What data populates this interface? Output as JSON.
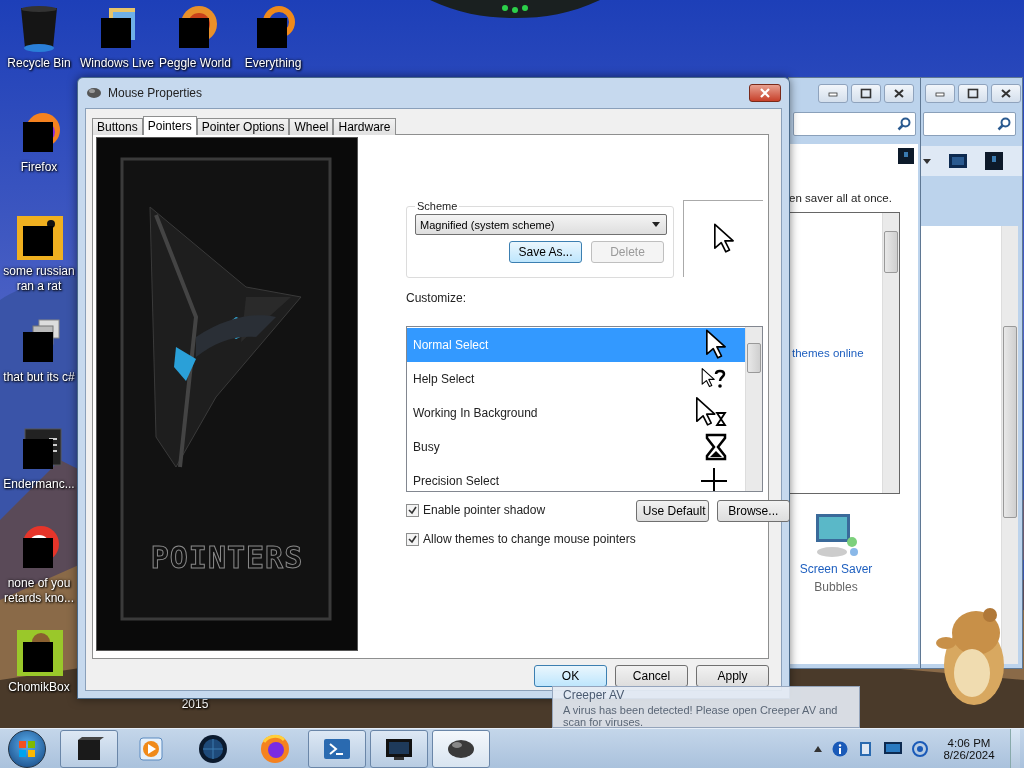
{
  "desktop_icons": [
    {
      "label": "Recycle Bin",
      "kind": "bin"
    },
    {
      "label": "Windows Live",
      "kind": "folders"
    },
    {
      "label": "Peggle World",
      "kind": "orb"
    },
    {
      "label": "Everything",
      "kind": "ring"
    },
    {
      "label": "Firefox",
      "kind": "firefox"
    },
    {
      "label": "some russian ran a rat",
      "kind": "tile"
    },
    {
      "label": "that but its c#",
      "kind": "windows"
    },
    {
      "label": "Endermanc...",
      "kind": "console"
    },
    {
      "label": "none of you retards kno...",
      "kind": "circle"
    },
    {
      "label": "ChomikBox",
      "kind": "green"
    },
    {
      "label": "2015",
      "kind": "hidden"
    }
  ],
  "window_a": {
    "text": "en saver all at once.",
    "link": "themes online",
    "item_title": "Screen Saver",
    "item_subtitle": "Bubbles"
  },
  "dialog": {
    "title": "Mouse Properties",
    "tabs": [
      {
        "label": "Buttons",
        "selected": false
      },
      {
        "label": "Pointers",
        "selected": true
      },
      {
        "label": "Pointer Options",
        "selected": false
      },
      {
        "label": "Wheel",
        "selected": false
      },
      {
        "label": "Hardware",
        "selected": false
      }
    ],
    "banner_text": "POINTERS",
    "scheme": {
      "label": "Scheme",
      "value": "Magnified (system scheme)",
      "buttons": [
        {
          "label": "Save As...",
          "disabled": false
        },
        {
          "label": "Delete",
          "disabled": true
        }
      ]
    },
    "customize_label": "Customize:",
    "pointers": [
      {
        "name": "Normal Select",
        "kind": "arrow",
        "selected": true
      },
      {
        "name": "Help Select",
        "kind": "help",
        "selected": false
      },
      {
        "name": "Working In Background",
        "kind": "working",
        "selected": false
      },
      {
        "name": "Busy",
        "kind": "busy",
        "selected": false
      },
      {
        "name": "Precision Select",
        "kind": "precision",
        "selected": false
      }
    ],
    "checkboxes": [
      {
        "label": "Enable pointer shadow",
        "checked": true
      },
      {
        "label": "Allow themes to change mouse pointers",
        "checked": true
      }
    ],
    "side_buttons": [
      "Use Default",
      "Browse..."
    ],
    "footer_buttons": [
      {
        "label": "OK",
        "default": true
      },
      {
        "label": "Cancel",
        "default": false
      },
      {
        "label": "Apply",
        "default": false
      }
    ]
  },
  "notification": {
    "title": "Creeper AV",
    "message": "A virus has been detected! Please open Creeper AV and scan for viruses."
  },
  "taskbar": {
    "buttons": [
      {
        "kind": "box",
        "running": true,
        "selected": false
      },
      {
        "kind": "media",
        "running": false,
        "selected": false
      },
      {
        "kind": "globe",
        "running": false,
        "selected": false
      },
      {
        "kind": "firefox",
        "running": false,
        "selected": false
      },
      {
        "kind": "terminal",
        "running": true,
        "selected": false
      },
      {
        "kind": "monitor",
        "running": true,
        "selected": false
      },
      {
        "kind": "mouse",
        "running": true,
        "selected": true
      }
    ],
    "time": "4:06 PM",
    "date": "8/26/2024"
  }
}
